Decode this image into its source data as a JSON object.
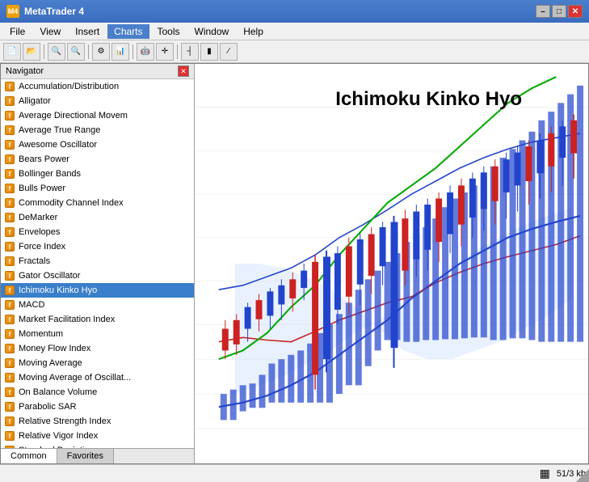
{
  "titleBar": {
    "text": "MetaTrader 4",
    "minimizeLabel": "–",
    "maximizeLabel": "□",
    "closeLabel": "✕"
  },
  "menuBar": {
    "items": [
      "File",
      "View",
      "Insert",
      "Charts",
      "Tools",
      "Window",
      "Help"
    ]
  },
  "innerTitleBar": {
    "minimizeLabel": "–",
    "maximizeLabel": "□",
    "closeLabel": "✕"
  },
  "navigator": {
    "title": "Navigator",
    "closeLabel": "✕",
    "items": [
      "Accumulation/Distribution",
      "Alligator",
      "Average Directional Movem",
      "Average True Range",
      "Awesome Oscillator",
      "Bears Power",
      "Bollinger Bands",
      "Bulls Power",
      "Commodity Channel Index",
      "DeMarker",
      "Envelopes",
      "Force Index",
      "Fractals",
      "Gator Oscillator",
      "Ichimoku Kinko Hyo",
      "MACD",
      "Market Facilitation Index",
      "Momentum",
      "Money Flow Index",
      "Moving Average",
      "Moving Average of Oscillat...",
      "On Balance Volume",
      "Parabolic SAR",
      "Relative Strength Index",
      "Relative Vigor Index",
      "Standard Deviation"
    ],
    "selectedItem": "Ichimoku Kinko Hyo",
    "tabs": [
      "Common",
      "Favorites"
    ]
  },
  "chart": {
    "label": "Ichimoku Kinko Hyo"
  },
  "statusBar": {
    "gridIcon": "▦",
    "pageInfo": "51/3 kb"
  }
}
